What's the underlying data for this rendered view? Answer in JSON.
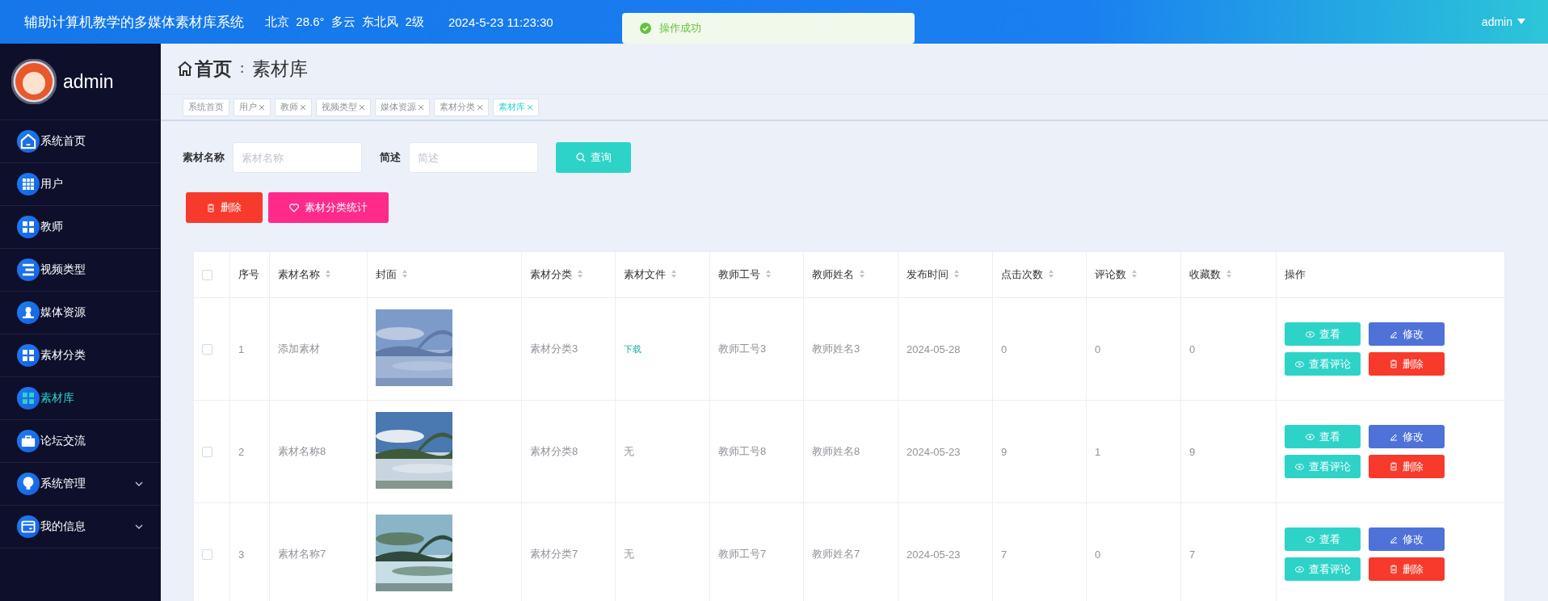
{
  "topbar": {
    "title": "辅助计算机教学的多媒体素材库系统",
    "weather": "北京  28.6°  多云  东北风  2级",
    "datetime": "2024-5-23 11:23:30",
    "user": "admin"
  },
  "toast": {
    "message": "操作成功"
  },
  "sidebar": {
    "username": "admin",
    "items": [
      {
        "label": "系统首页",
        "selected": false,
        "expandable": false
      },
      {
        "label": "用户",
        "selected": false,
        "expandable": false
      },
      {
        "label": "教师",
        "selected": false,
        "expandable": false
      },
      {
        "label": "视频类型",
        "selected": false,
        "expandable": false
      },
      {
        "label": "媒体资源",
        "selected": false,
        "expandable": false
      },
      {
        "label": "素材分类",
        "selected": false,
        "expandable": false
      },
      {
        "label": "素材库",
        "selected": true,
        "expandable": false
      },
      {
        "label": "论坛交流",
        "selected": false,
        "expandable": false
      },
      {
        "label": "系统管理",
        "selected": false,
        "expandable": true
      },
      {
        "label": "我的信息",
        "selected": false,
        "expandable": true
      }
    ]
  },
  "breadcrumb": {
    "home": "首页",
    "separator": ":",
    "current": "素材库"
  },
  "tags": [
    {
      "label": "系统首页",
      "closable": false,
      "selected": false
    },
    {
      "label": "用户",
      "closable": true,
      "selected": false
    },
    {
      "label": "教师",
      "closable": true,
      "selected": false
    },
    {
      "label": "视频类型",
      "closable": true,
      "selected": false
    },
    {
      "label": "媒体资源",
      "closable": true,
      "selected": false
    },
    {
      "label": "素材分类",
      "closable": true,
      "selected": false
    },
    {
      "label": "素材库",
      "closable": true,
      "selected": true
    }
  ],
  "search": {
    "fields": [
      {
        "label": "素材名称",
        "placeholder": "素材名称"
      },
      {
        "label": "简述",
        "placeholder": "简述"
      }
    ],
    "button": "查询"
  },
  "actions": [
    {
      "label": "删除",
      "kind": "delete"
    },
    {
      "label": "素材分类统计",
      "kind": "stats"
    }
  ],
  "table": {
    "columns": [
      {
        "label": "序号",
        "sortable": false
      },
      {
        "label": "素材名称",
        "sortable": true
      },
      {
        "label": "封面",
        "sortable": true
      },
      {
        "label": "素材分类",
        "sortable": true
      },
      {
        "label": "素材文件",
        "sortable": true
      },
      {
        "label": "教师工号",
        "sortable": true
      },
      {
        "label": "教师姓名",
        "sortable": true
      },
      {
        "label": "发布时间",
        "sortable": true
      },
      {
        "label": "点击次数",
        "sortable": true
      },
      {
        "label": "评论数",
        "sortable": true
      },
      {
        "label": "收藏数",
        "sortable": true
      },
      {
        "label": "操作",
        "sortable": false
      }
    ],
    "header_checked": false,
    "rows": [
      {
        "checked": false,
        "cells": [
          "1",
          "添加素材",
          {
            "kind": "picture"
          },
          "素材分类3",
          {
            "text": "下载",
            "kind": "link"
          },
          "教师工号3",
          "教师姓名3",
          "2024-05-28",
          "0",
          "0",
          "0"
        ],
        "buttons": [
          {
            "label": "查看",
            "kind": "view"
          },
          {
            "label": "修改",
            "kind": "edit"
          },
          {
            "label": "查看评论",
            "kind": "view"
          },
          {
            "label": "删除",
            "kind": "delete"
          }
        ]
      },
      {
        "checked": false,
        "cells": [
          "2",
          "素材名称8",
          {
            "kind": "picture"
          },
          "素材分类8",
          {
            "text": "无",
            "kind": "text"
          },
          "教师工号8",
          "教师姓名8",
          "2024-05-23",
          "9",
          "1",
          "9"
        ],
        "buttons": [
          {
            "label": "查看",
            "kind": "view"
          },
          {
            "label": "修改",
            "kind": "edit"
          },
          {
            "label": "查看评论",
            "kind": "view"
          },
          {
            "label": "删除",
            "kind": "delete"
          }
        ]
      },
      {
        "checked": false,
        "cells": [
          "3",
          "素材名称7",
          {
            "kind": "picture"
          },
          "素材分类7",
          {
            "text": "无",
            "kind": "text"
          },
          "教师工号7",
          "教师姓名7",
          "2024-05-23",
          "7",
          "0",
          "7"
        ],
        "buttons": [
          {
            "label": "查看",
            "kind": "view"
          },
          {
            "label": "修改",
            "kind": "edit"
          },
          {
            "label": "查看评论",
            "kind": "view"
          },
          {
            "label": "删除",
            "kind": "delete"
          }
        ]
      }
    ]
  }
}
